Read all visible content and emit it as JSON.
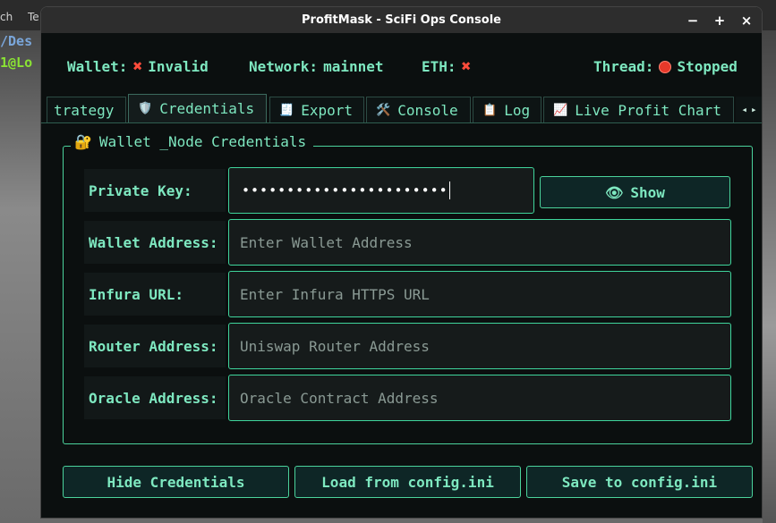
{
  "background": {
    "menu_items": [
      "ch",
      "Te"
    ],
    "terminal_lines": [
      "/Des",
      "1@Lo"
    ]
  },
  "window": {
    "title": "ProfitMask - SciFi Ops Console",
    "controls": {
      "minimize": "−",
      "maximize": "+",
      "close": "×"
    }
  },
  "status": {
    "wallet_label": "Wallet:",
    "wallet_value": "Invalid",
    "network_label": "Network:",
    "network_value": "mainnet",
    "eth_label": "ETH:",
    "thread_label": "Thread:",
    "thread_value": "Stopped"
  },
  "tabs": [
    {
      "label": "trategy",
      "icon": ""
    },
    {
      "label": "Credentials",
      "icon": "🛡️",
      "active": true
    },
    {
      "label": "Export",
      "icon": "🧾"
    },
    {
      "label": "Console",
      "icon": "🛠️"
    },
    {
      "label": "Log",
      "icon": "📋"
    },
    {
      "label": "Live Profit Chart",
      "icon": "📈"
    }
  ],
  "tab_scroll": {
    "left": "◂",
    "right": "▸"
  },
  "credentials": {
    "group_title": "Wallet _Node Credentials",
    "group_icon": "🔐",
    "private_key_label": "Private Key:",
    "private_key_mask": "•••••••••••••••••••••••",
    "show_label": "Show",
    "show_icon": "👁",
    "wallet_address_label": "Wallet Address:",
    "wallet_address_placeholder": "Enter Wallet Address",
    "infura_label": "Infura URL:",
    "infura_placeholder": "Enter Infura HTTPS URL",
    "router_label": "Router Address:",
    "router_placeholder": "Uniswap Router Address",
    "oracle_label": "Oracle Address:",
    "oracle_placeholder": "Oracle Contract Address"
  },
  "actions": {
    "hide": "Hide Credentials",
    "load": "Load from config.ini",
    "save": "Save to config.ini"
  },
  "colors": {
    "accent": "#7ee8c0",
    "border": "#4bd39c",
    "error": "#ff4c3b",
    "window_bg": "#0b0f0f"
  }
}
